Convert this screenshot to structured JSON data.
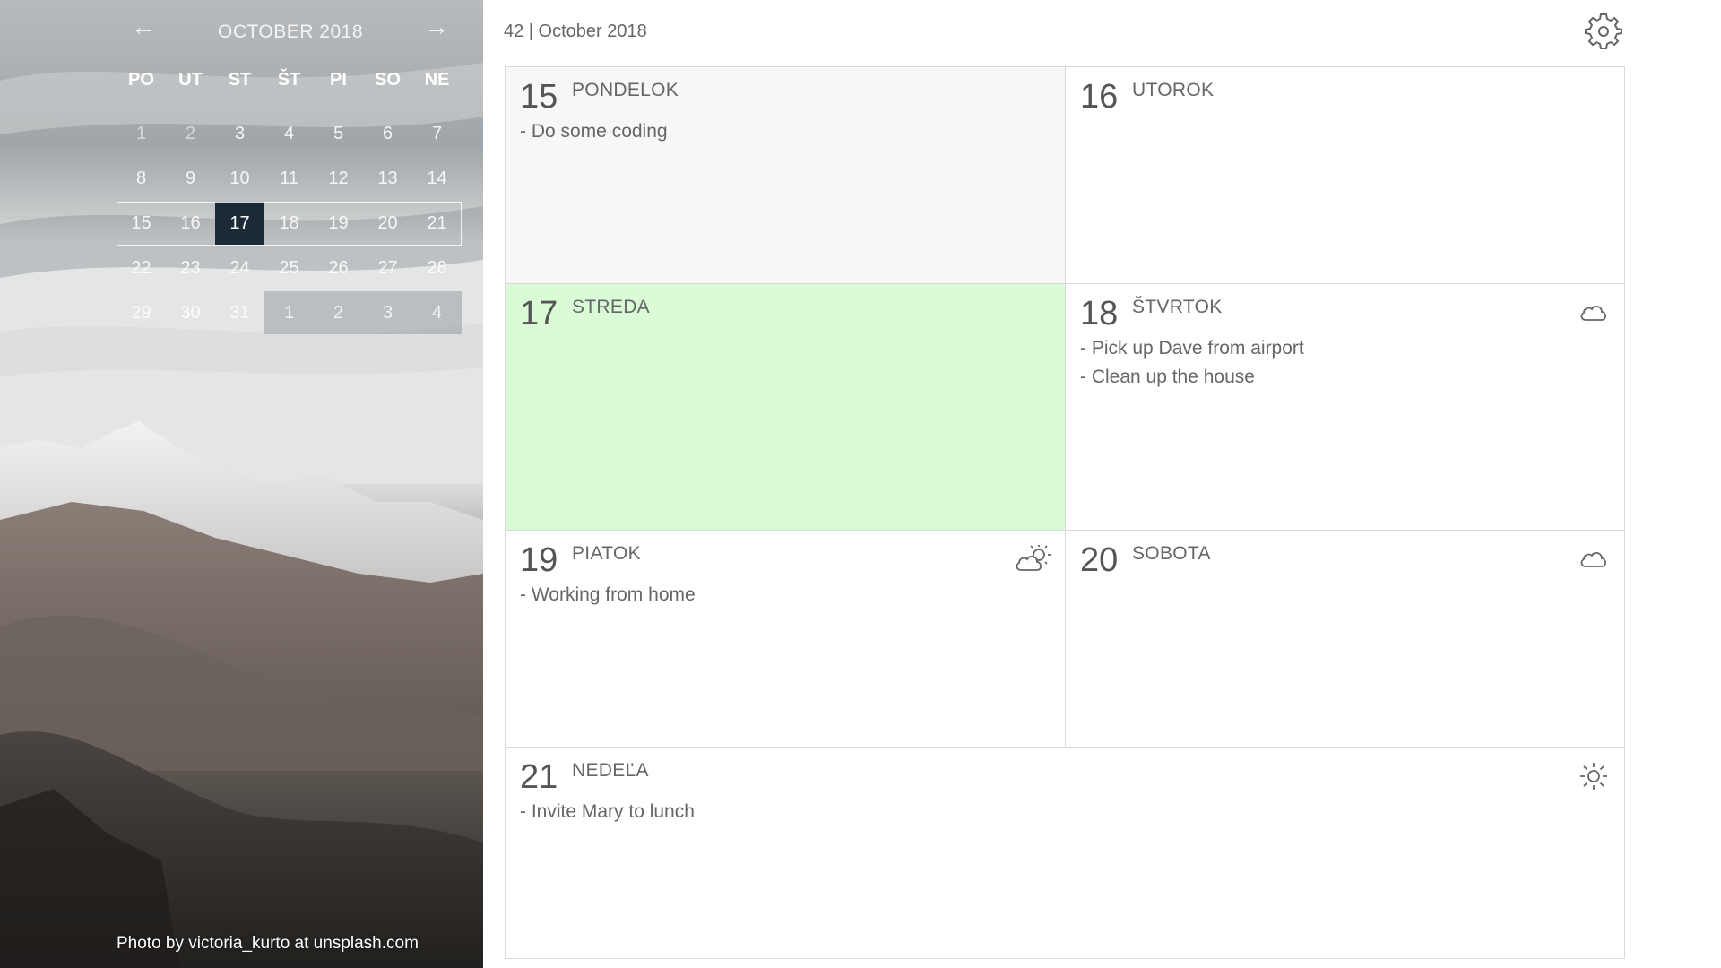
{
  "header": {
    "title": "42 | October 2018",
    "settings_icon": "gear-icon"
  },
  "mini_calendar": {
    "prev_arrow": "←",
    "next_arrow": "→",
    "month": "OCTOBER 2018",
    "weekdays": [
      "PO",
      "UT",
      "ST",
      "ŠT",
      "PI",
      "SO",
      "NE"
    ],
    "weeks": [
      [
        "1",
        "2",
        "3",
        "4",
        "5",
        "6",
        "7"
      ],
      [
        "8",
        "9",
        "10",
        "11",
        "12",
        "13",
        "14"
      ],
      [
        "15",
        "16",
        "17",
        "18",
        "19",
        "20",
        "21"
      ],
      [
        "22",
        "23",
        "24",
        "25",
        "26",
        "27",
        "28"
      ],
      [
        "29",
        "30",
        "31",
        "1",
        "2",
        "3",
        "4"
      ]
    ],
    "selected_day": "17"
  },
  "photo_credit": "Photo by victoria_kurto at unsplash.com",
  "days": [
    {
      "num": "15",
      "name": "PONDELOK",
      "tasks": [
        "- Do some coding"
      ],
      "weather": ""
    },
    {
      "num": "16",
      "name": "UTOROK",
      "tasks": [],
      "weather": ""
    },
    {
      "num": "17",
      "name": "STREDA",
      "tasks": [],
      "weather": ""
    },
    {
      "num": "18",
      "name": "ŠTVRTOK",
      "tasks": [
        "- Pick up Dave from airport",
        "- Clean up the house"
      ],
      "weather": "cloud-icon"
    },
    {
      "num": "19",
      "name": "PIATOK",
      "tasks": [
        "- Working from home"
      ],
      "weather": "partly-sunny-icon"
    },
    {
      "num": "20",
      "name": "SOBOTA",
      "tasks": [],
      "weather": "cloud-icon"
    },
    {
      "num": "21",
      "name": "NEDEĽA",
      "tasks": [
        "- Invite Mary to lunch"
      ],
      "weather": "sun-icon"
    }
  ],
  "colors": {
    "today_cell": "#d9fbd5",
    "past_cell": "#f7f7f7",
    "selected_day_bg": "#1b2a36"
  }
}
